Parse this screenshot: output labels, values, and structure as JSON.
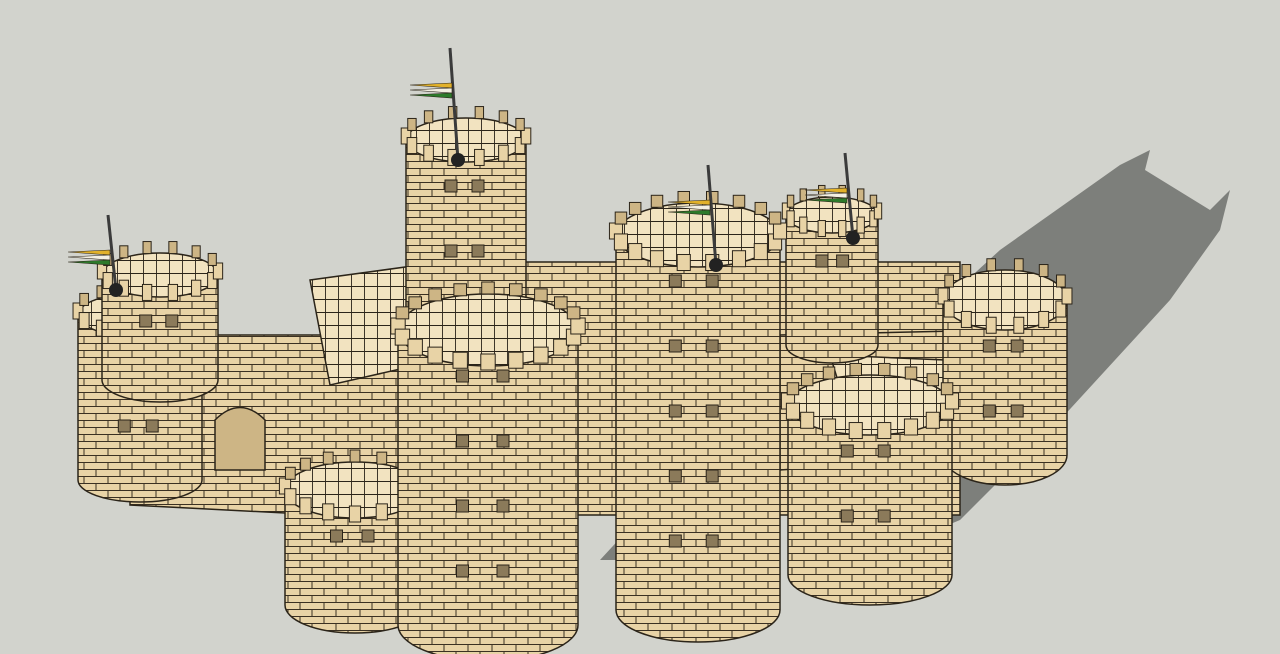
{
  "scene": {
    "subject": "castle-model",
    "colors": {
      "background": "#d2d3cd",
      "shadow": "#6f706c",
      "stone": "#e8d3a6",
      "stone_dark": "#cdb585",
      "top_face": "#f2e3c0",
      "outline": "#2b2419",
      "brick_line": "#3a3022",
      "window": "#8b7a5a",
      "door": "#8a3d1c",
      "pole": "#3b3b3b",
      "flag_yellow": "#e2b12a",
      "flag_green": "#2d7a2a",
      "flag_white": "#f3efe2"
    },
    "icons": [
      "flag-icon",
      "battlement-icon",
      "window-icon",
      "door-icon"
    ]
  }
}
